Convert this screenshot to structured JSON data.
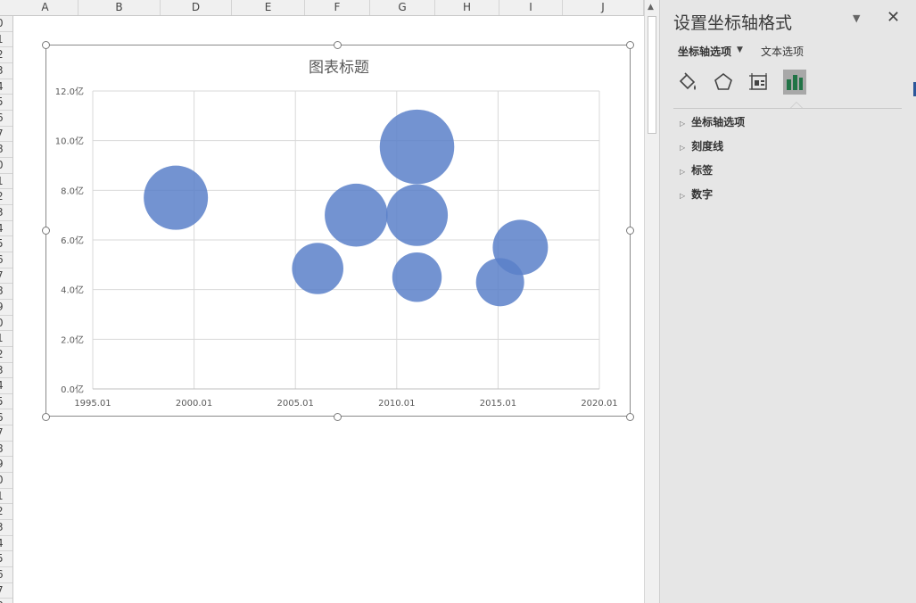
{
  "spreadsheet": {
    "columns": [
      "A",
      "B",
      "D",
      "E",
      "F",
      "G",
      "H",
      "I",
      "J"
    ],
    "rows": [
      "0",
      "1",
      "2",
      "3",
      "4",
      "5",
      "6",
      "7",
      "8",
      "0",
      "1",
      "2",
      "3",
      "4",
      "5",
      "6",
      "7",
      "8",
      "9",
      "0",
      "1",
      "2",
      "3",
      "4",
      "5",
      "6",
      "7",
      "8",
      "9",
      "0",
      "1",
      "2",
      "3",
      "4",
      "5",
      "6",
      "7",
      "8"
    ]
  },
  "chart_data": {
    "type": "scatter",
    "subtype": "bubble",
    "title": "图表标题",
    "x_tick_labels": [
      "1995.01",
      "2000.01",
      "2005.01",
      "2010.01",
      "2015.01",
      "2020.01"
    ],
    "y_tick_labels": [
      "0.0亿",
      "2.0亿",
      "4.0亿",
      "6.0亿",
      "8.0亿",
      "10.0亿",
      "12.0亿"
    ],
    "xlim": [
      1995,
      2020
    ],
    "ylim": [
      0,
      12
    ],
    "grid": true,
    "legend": "none",
    "color": "#5b80c9",
    "points": [
      {
        "x": 1999.1,
        "y": 7.7,
        "size": 1.0
      },
      {
        "x": 2006.1,
        "y": 4.85,
        "size": 0.8
      },
      {
        "x": 2008.0,
        "y": 7.0,
        "size": 0.98
      },
      {
        "x": 2011.0,
        "y": 9.75,
        "size": 1.16
      },
      {
        "x": 2011.0,
        "y": 7.0,
        "size": 0.96
      },
      {
        "x": 2011.0,
        "y": 4.5,
        "size": 0.77
      },
      {
        "x": 2015.1,
        "y": 4.3,
        "size": 0.75
      },
      {
        "x": 2016.1,
        "y": 5.7,
        "size": 0.86
      }
    ]
  },
  "panel": {
    "title": "设置坐标轴格式",
    "tab_axis_options": "坐标轴选项",
    "tab_text_options": "文本选项",
    "sections": [
      "坐标轴选项",
      "刻度线",
      "标签",
      "数字"
    ],
    "icons": [
      "fill-line-icon",
      "effects-pentagon-icon",
      "size-properties-icon",
      "axis-options-bar-chart-icon"
    ],
    "active_color": "#217346"
  }
}
